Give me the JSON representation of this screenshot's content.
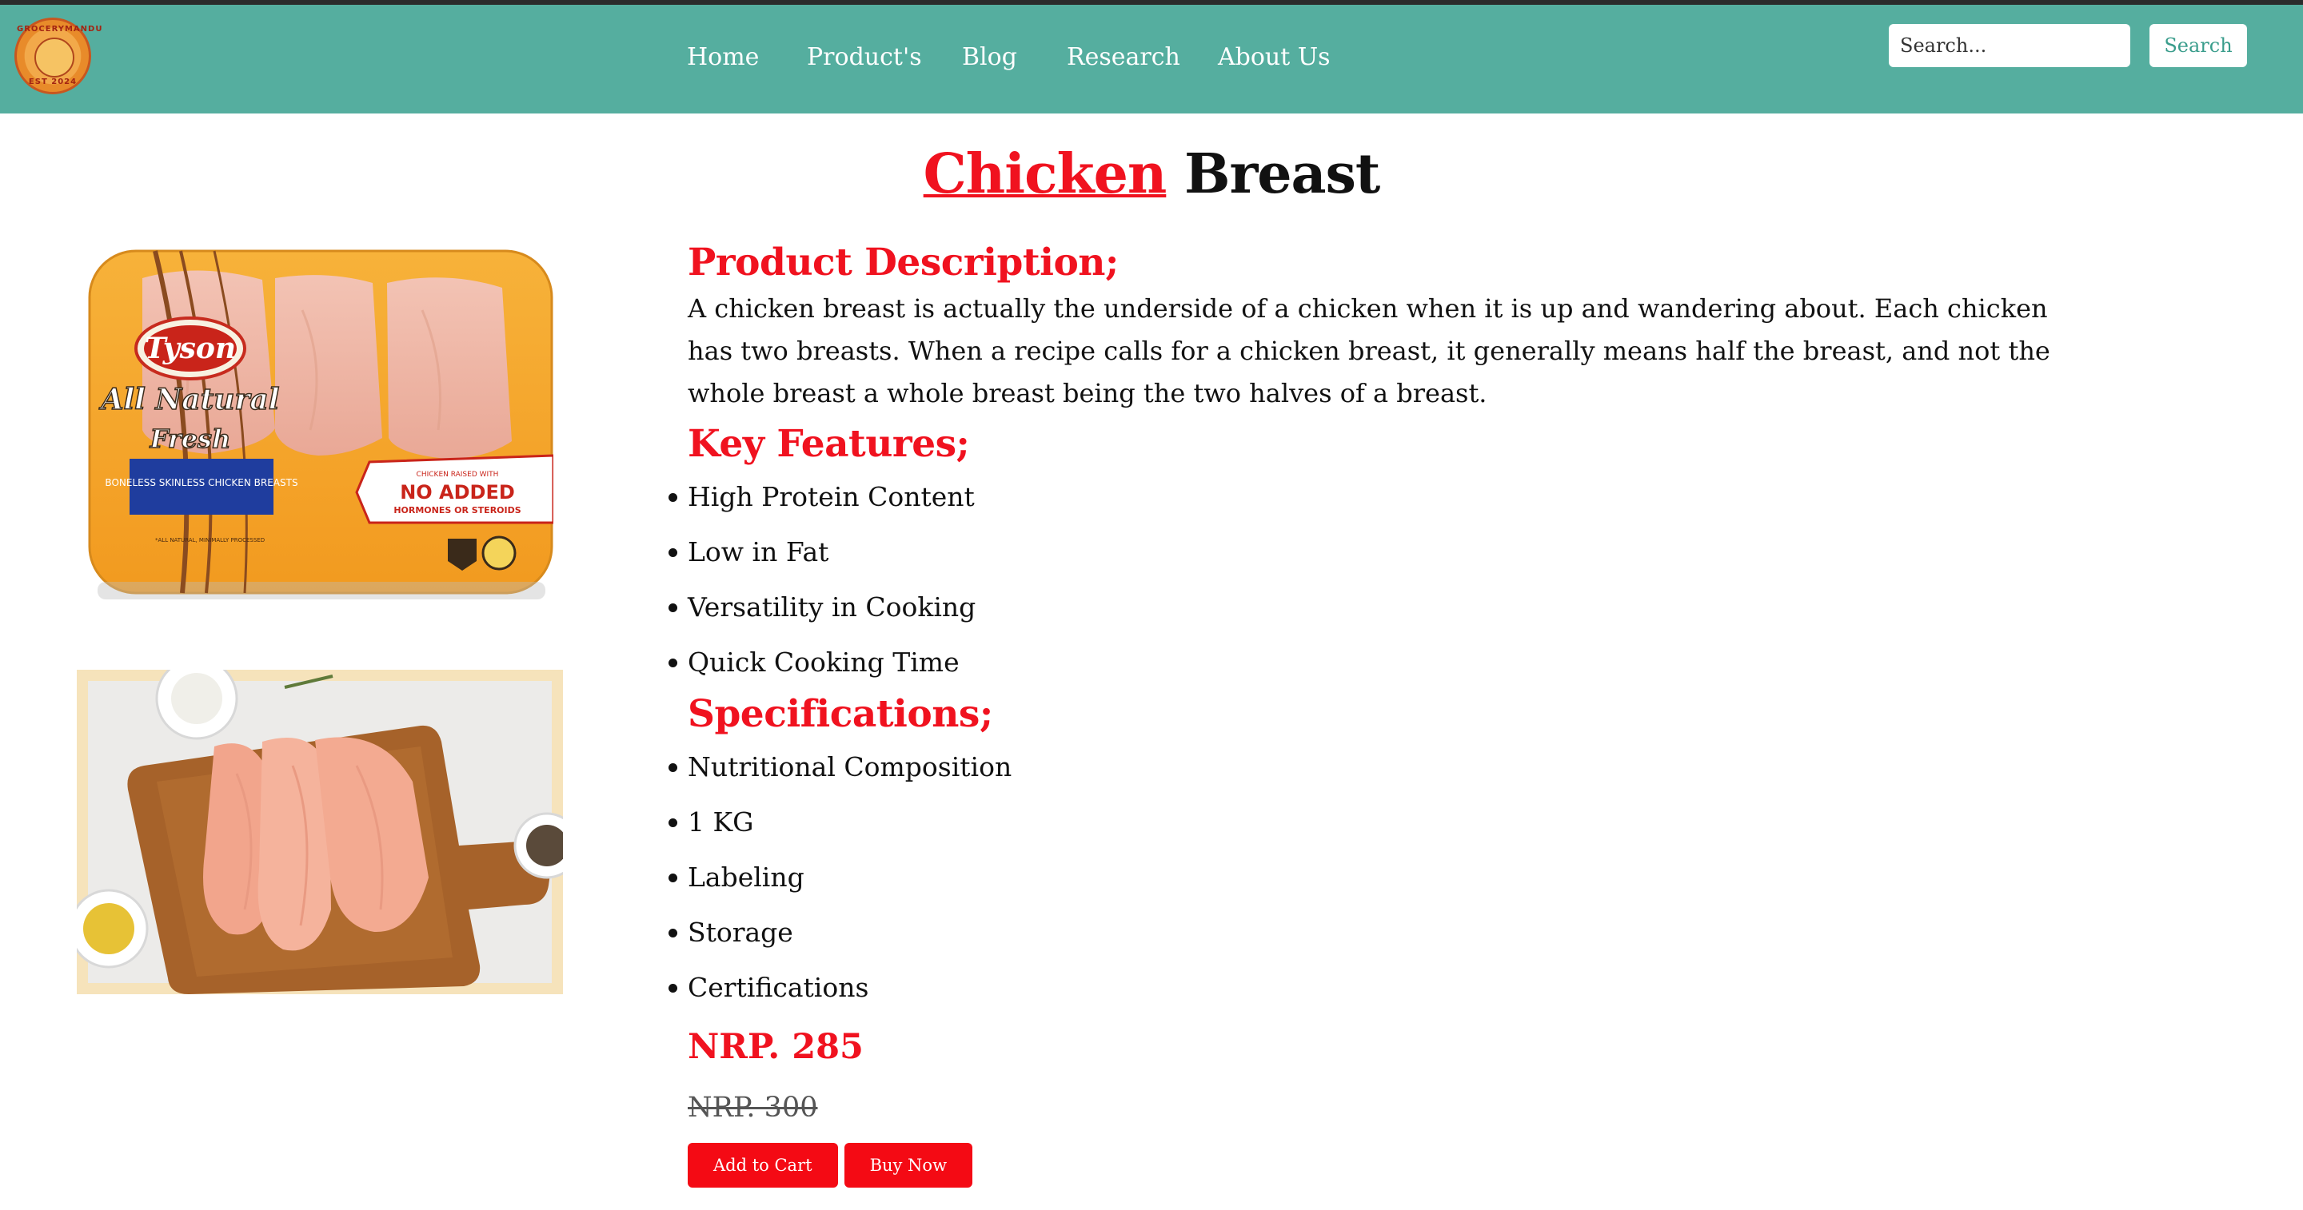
{
  "nav": {
    "logo": {
      "ring_top": "GROCERYMANDU",
      "ring_bottom": "EST 2024",
      "icon": "store-logo"
    },
    "links": [
      "Home",
      "Product's",
      "Blog",
      "Research",
      "About Us"
    ],
    "search": {
      "placeholder": "Search...",
      "button_label": "Search"
    }
  },
  "product": {
    "title_accent": "Chicken",
    "title_rest": "Breast",
    "images": [
      {
        "label_brand": "Tyson",
        "label_line1": "All Natural",
        "label_line2": "Fresh",
        "label_box": "BONELESS SKINLESS CHICKEN BREASTS",
        "badge_small": "CHICKEN RAISED WITH",
        "badge_big": "NO ADDED",
        "badge_sub": "HORMONES OR STEROIDS"
      },
      {
        "description": "raw chicken breasts on wooden board"
      }
    ],
    "description_heading": "Product Description;",
    "description": "A chicken breast is actually the underside of a chicken when it is up and wandering about. Each chicken has two breasts. When a recipe calls for a chicken breast, it generally means half the breast, and not the whole breast a whole breast being the two halves of a breast.",
    "features_heading": "Key Features;",
    "features": [
      "High Protein Content",
      "Low in Fat",
      "Versatility in Cooking",
      "Quick Cooking Time"
    ],
    "specs_heading": "Specifications;",
    "specs": [
      "Nutritional Composition",
      "1 KG",
      "Labeling",
      "Storage",
      "Certifications"
    ],
    "price": "NRP. 285",
    "old_price": "NRP. 300",
    "add_to_cart_label": "Add to Cart",
    "buy_now_label": "Buy Now"
  },
  "colors": {
    "navbar": "#55ae9f",
    "accent_red": "#f0121f",
    "button_red": "#f40a14"
  }
}
